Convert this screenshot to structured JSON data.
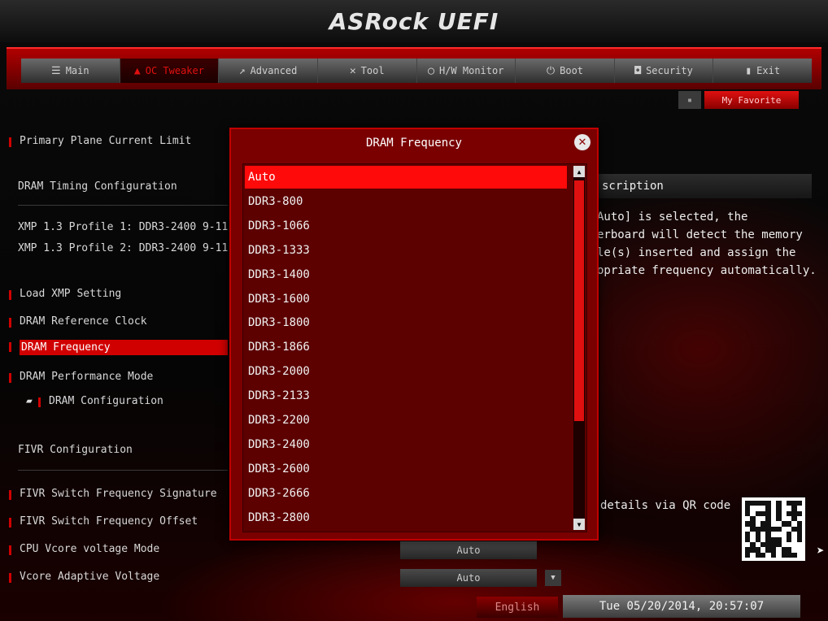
{
  "header": {
    "brand": "ASRock UEFI"
  },
  "nav": {
    "tabs": [
      {
        "label": "Main",
        "icon": "menu-icon"
      },
      {
        "label": "OC Tweaker",
        "icon": "flame-icon",
        "active": true
      },
      {
        "label": "Advanced",
        "icon": "arrow-icon"
      },
      {
        "label": "Tool",
        "icon": "wrench-icon"
      },
      {
        "label": "H/W Monitor",
        "icon": "monitor-icon"
      },
      {
        "label": "Boot",
        "icon": "power-icon"
      },
      {
        "label": "Security",
        "icon": "shield-icon"
      },
      {
        "label": "Exit",
        "icon": "exit-icon"
      }
    ],
    "favorite_label": "My Favorite"
  },
  "settings": {
    "primary_plane": "Primary Plane Current Limit",
    "dram_timing_header": "DRAM Timing Configuration",
    "xmp1": "XMP 1.3 Profile 1: DDR3-2400 9-11",
    "xmp2": "XMP 1.3 Profile 2: DDR3-2400 9-11",
    "load_xmp": "Load XMP Setting",
    "ref_clock": "DRAM Reference Clock",
    "dram_freq": "DRAM Frequency",
    "perf_mode": "DRAM Performance Mode",
    "dram_config": "DRAM Configuration",
    "fivr_header": "FIVR Configuration",
    "fivr_sig": "FIVR Switch Frequency Signature",
    "fivr_offset": "FIVR Switch Frequency Offset",
    "vcore_mode": "CPU Vcore voltage Mode",
    "vcore_adaptive": "Vcore Adaptive Voltage",
    "vcore_mode_value": "Auto",
    "vcore_adaptive_value": "Auto"
  },
  "description": {
    "title": "scription",
    "line1": "Auto] is selected, the",
    "line2": "erboard will detect the memory",
    "line3": "le(s) inserted and assign the",
    "line4": "opriate frequency automatically.",
    "qr_label": "details via QR code"
  },
  "footer": {
    "language": "English",
    "datetime": "Tue 05/20/2014, 20:57:07"
  },
  "popup": {
    "title": "DRAM Frequency",
    "options": [
      "Auto",
      "DDR3-800",
      "DDR3-1066",
      "DDR3-1333",
      "DDR3-1400",
      "DDR3-1600",
      "DDR3-1800",
      "DDR3-1866",
      "DDR3-2000",
      "DDR3-2133",
      "DDR3-2200",
      "DDR3-2400",
      "DDR3-2600",
      "DDR3-2666",
      "DDR3-2800"
    ],
    "selected_index": 0
  },
  "colors": {
    "accent": "#d00000",
    "selected": "#ff0a0a",
    "popup_bg": "#7a0000"
  }
}
